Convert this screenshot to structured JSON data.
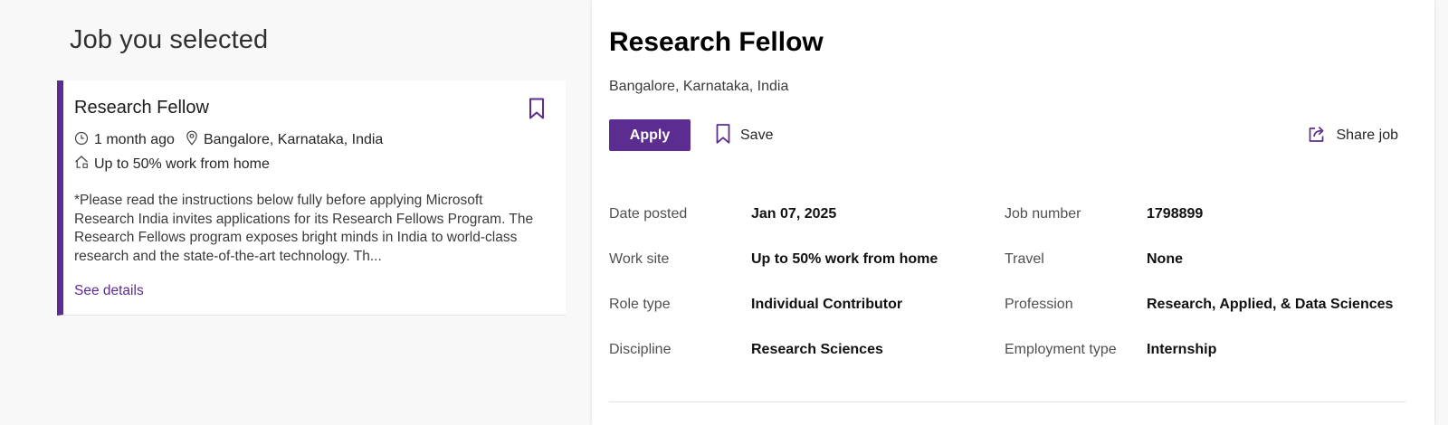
{
  "left": {
    "heading": "Job you selected",
    "card": {
      "title": "Research Fellow",
      "posted": "1 month ago",
      "location": "Bangalore, Karnataka, India",
      "work_site": "Up to 50% work from home",
      "description": "*Please read the instructions below fully before applying Microsoft Research India invites applications for its Research Fellows Program. The Research Fellows program exposes bright minds in India to world-class research and the state-of-the-art technology. Th...",
      "see_details": "See details"
    }
  },
  "detail": {
    "title": "Research Fellow",
    "location": "Bangalore, Karnataka, India",
    "apply_label": "Apply",
    "save_label": "Save",
    "share_label": "Share job",
    "fields": {
      "date_posted": {
        "label": "Date posted",
        "value": "Jan 07, 2025"
      },
      "job_number": {
        "label": "Job number",
        "value": "1798899"
      },
      "work_site": {
        "label": "Work site",
        "value": "Up to 50% work from home"
      },
      "travel": {
        "label": "Travel",
        "value": "None"
      },
      "role_type": {
        "label": "Role type",
        "value": "Individual Contributor"
      },
      "profession": {
        "label": "Profession",
        "value": "Research, Applied, & Data Sciences"
      },
      "discipline": {
        "label": "Discipline",
        "value": "Research Sciences"
      },
      "employment_type": {
        "label": "Employment type",
        "value": "Internship"
      }
    }
  },
  "colors": {
    "accent": "#5c2d91",
    "page_background": "#f8f8f8",
    "panel_background": "#ffffff"
  },
  "icons": [
    "bookmark-icon",
    "clock-icon",
    "location-pin-icon",
    "home-work-icon",
    "share-icon"
  ]
}
